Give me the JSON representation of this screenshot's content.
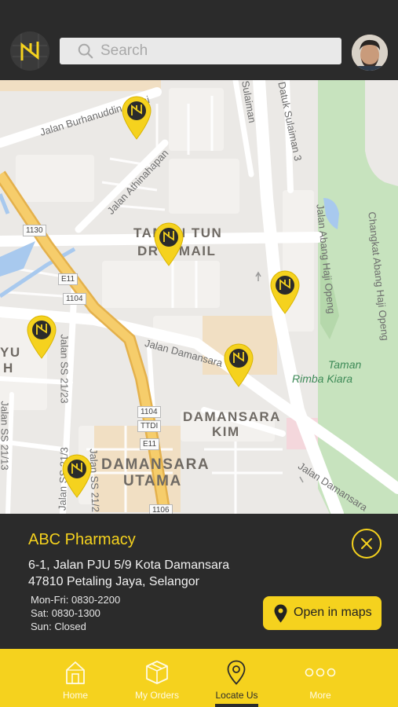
{
  "header": {
    "search": {
      "placeholder": "Search",
      "value": ""
    }
  },
  "map": {
    "streets": [
      "Jalan Burhanuddin Helmi",
      "Jalan Athinahapan",
      "Jalan Damansara",
      "Datuk Sulaiman 3",
      "Sulaiman",
      "Jalan Abang Haji Openg",
      "Changkat Abang Haji Openg",
      "Jalan SS 21/23",
      "Jalan SS 21/13",
      "Jalan SS 21/3",
      "Jalan SS 21/2",
      "Jalan Damansara"
    ],
    "areas": [
      "TAMAN TUN",
      "DR ISMAIL",
      "DAMANSARA",
      "KIM",
      "DAMANSARA",
      "UTAMA",
      "YU",
      "H"
    ],
    "park": [
      "Taman",
      "Rimba Kiara"
    ],
    "route_shields": [
      "1130",
      "E11",
      "1104",
      "1104",
      "TTDI",
      "E11",
      "1106"
    ]
  },
  "place": {
    "name": "ABC Pharmacy",
    "address_line1": "6-1, Jalan PJU 5/9 Kota Damansara",
    "address_line2": "47810 Petaling Jaya, Selangor",
    "hours": [
      "Mon-Fri: 0830-2200",
      "Sat: 0830-1300",
      "Sun: Closed"
    ],
    "open_maps_label": "Open in maps"
  },
  "nav": {
    "items": [
      {
        "label": "Home",
        "icon": "home-icon",
        "active": false
      },
      {
        "label": "My Orders",
        "icon": "box-icon",
        "active": false
      },
      {
        "label": "Locate Us",
        "icon": "location-pin-icon",
        "active": true
      },
      {
        "label": "More",
        "icon": "more-dots-icon",
        "active": false
      }
    ]
  },
  "colors": {
    "accent": "#f5d21e",
    "dark": "#2b2b2b",
    "map_bg": "#ebe9e6"
  }
}
